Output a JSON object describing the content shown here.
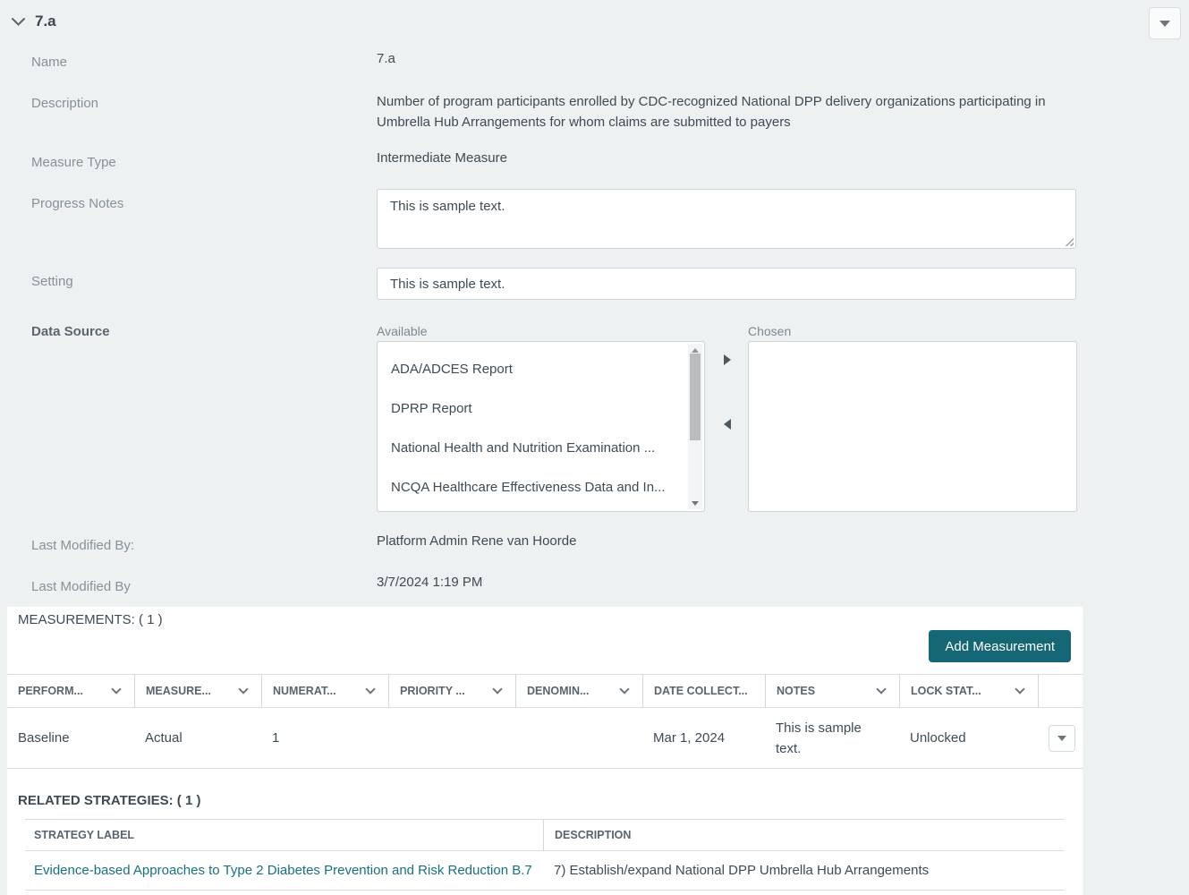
{
  "colors": {
    "page_background": "#edf1f2",
    "panel_background": "#ffffff",
    "accent_teal": "#166775",
    "link_teal": "#17707f"
  },
  "header": {
    "title": "7.a"
  },
  "form": {
    "name": {
      "label": "Name",
      "value": "7.a"
    },
    "description": {
      "label": "Description",
      "value": "Number of program participants enrolled by CDC-recognized National DPP delivery organizations participating in Umbrella Hub Arrangements for whom claims are submitted to payers"
    },
    "measure_type": {
      "label": "Measure Type",
      "value": "Intermediate Measure"
    },
    "progress_notes": {
      "label": "Progress Notes",
      "value": "This is sample text."
    },
    "setting": {
      "label": "Setting",
      "value": "This is sample text."
    },
    "data_source": {
      "label": "Data Source",
      "available_label": "Available",
      "chosen_label": "Chosen",
      "available_options": [
        "ADA/ADCES Report",
        "DPRP Report",
        "National Health and Nutrition Examination ...",
        "NCQA Healthcare Effectiveness Data and In..."
      ],
      "chosen_options": []
    },
    "last_modified_by": {
      "label": "Last Modified By:",
      "value": "Platform Admin Rene van Hoorde"
    },
    "last_modified_date": {
      "label": "Last Modified By",
      "value": "3/7/2024 1:19 PM"
    }
  },
  "measurements": {
    "title": "MEASUREMENTS: ( 1 )",
    "add_button_label": "Add Measurement",
    "columns": {
      "performance": "PERFORM...",
      "measure": "MEASURE...",
      "numerator": "NUMERAT...",
      "priority": "PRIORITY ...",
      "denominator": "DENOMIN...",
      "date_collected": "DATE COLLECT...",
      "notes": "NOTES",
      "lock_status": "LOCK STAT..."
    },
    "rows": [
      {
        "performance": "Baseline",
        "measure": "Actual",
        "numerator": "1",
        "priority": "",
        "denominator": "",
        "date_collected": "Mar 1, 2024",
        "notes": "This is sample text.",
        "lock_status": "Unlocked"
      }
    ]
  },
  "related_strategies": {
    "title": "RELATED STRATEGIES: ( 1 )",
    "columns": {
      "strategy_label": "STRATEGY LABEL",
      "description": "DESCRIPTION"
    },
    "rows": [
      {
        "strategy_label": "Evidence-based Approaches to Type 2 Diabetes Prevention and Risk Reduction B.7",
        "description": "7) Establish/expand National DPP Umbrella Hub Arrangements"
      }
    ]
  }
}
